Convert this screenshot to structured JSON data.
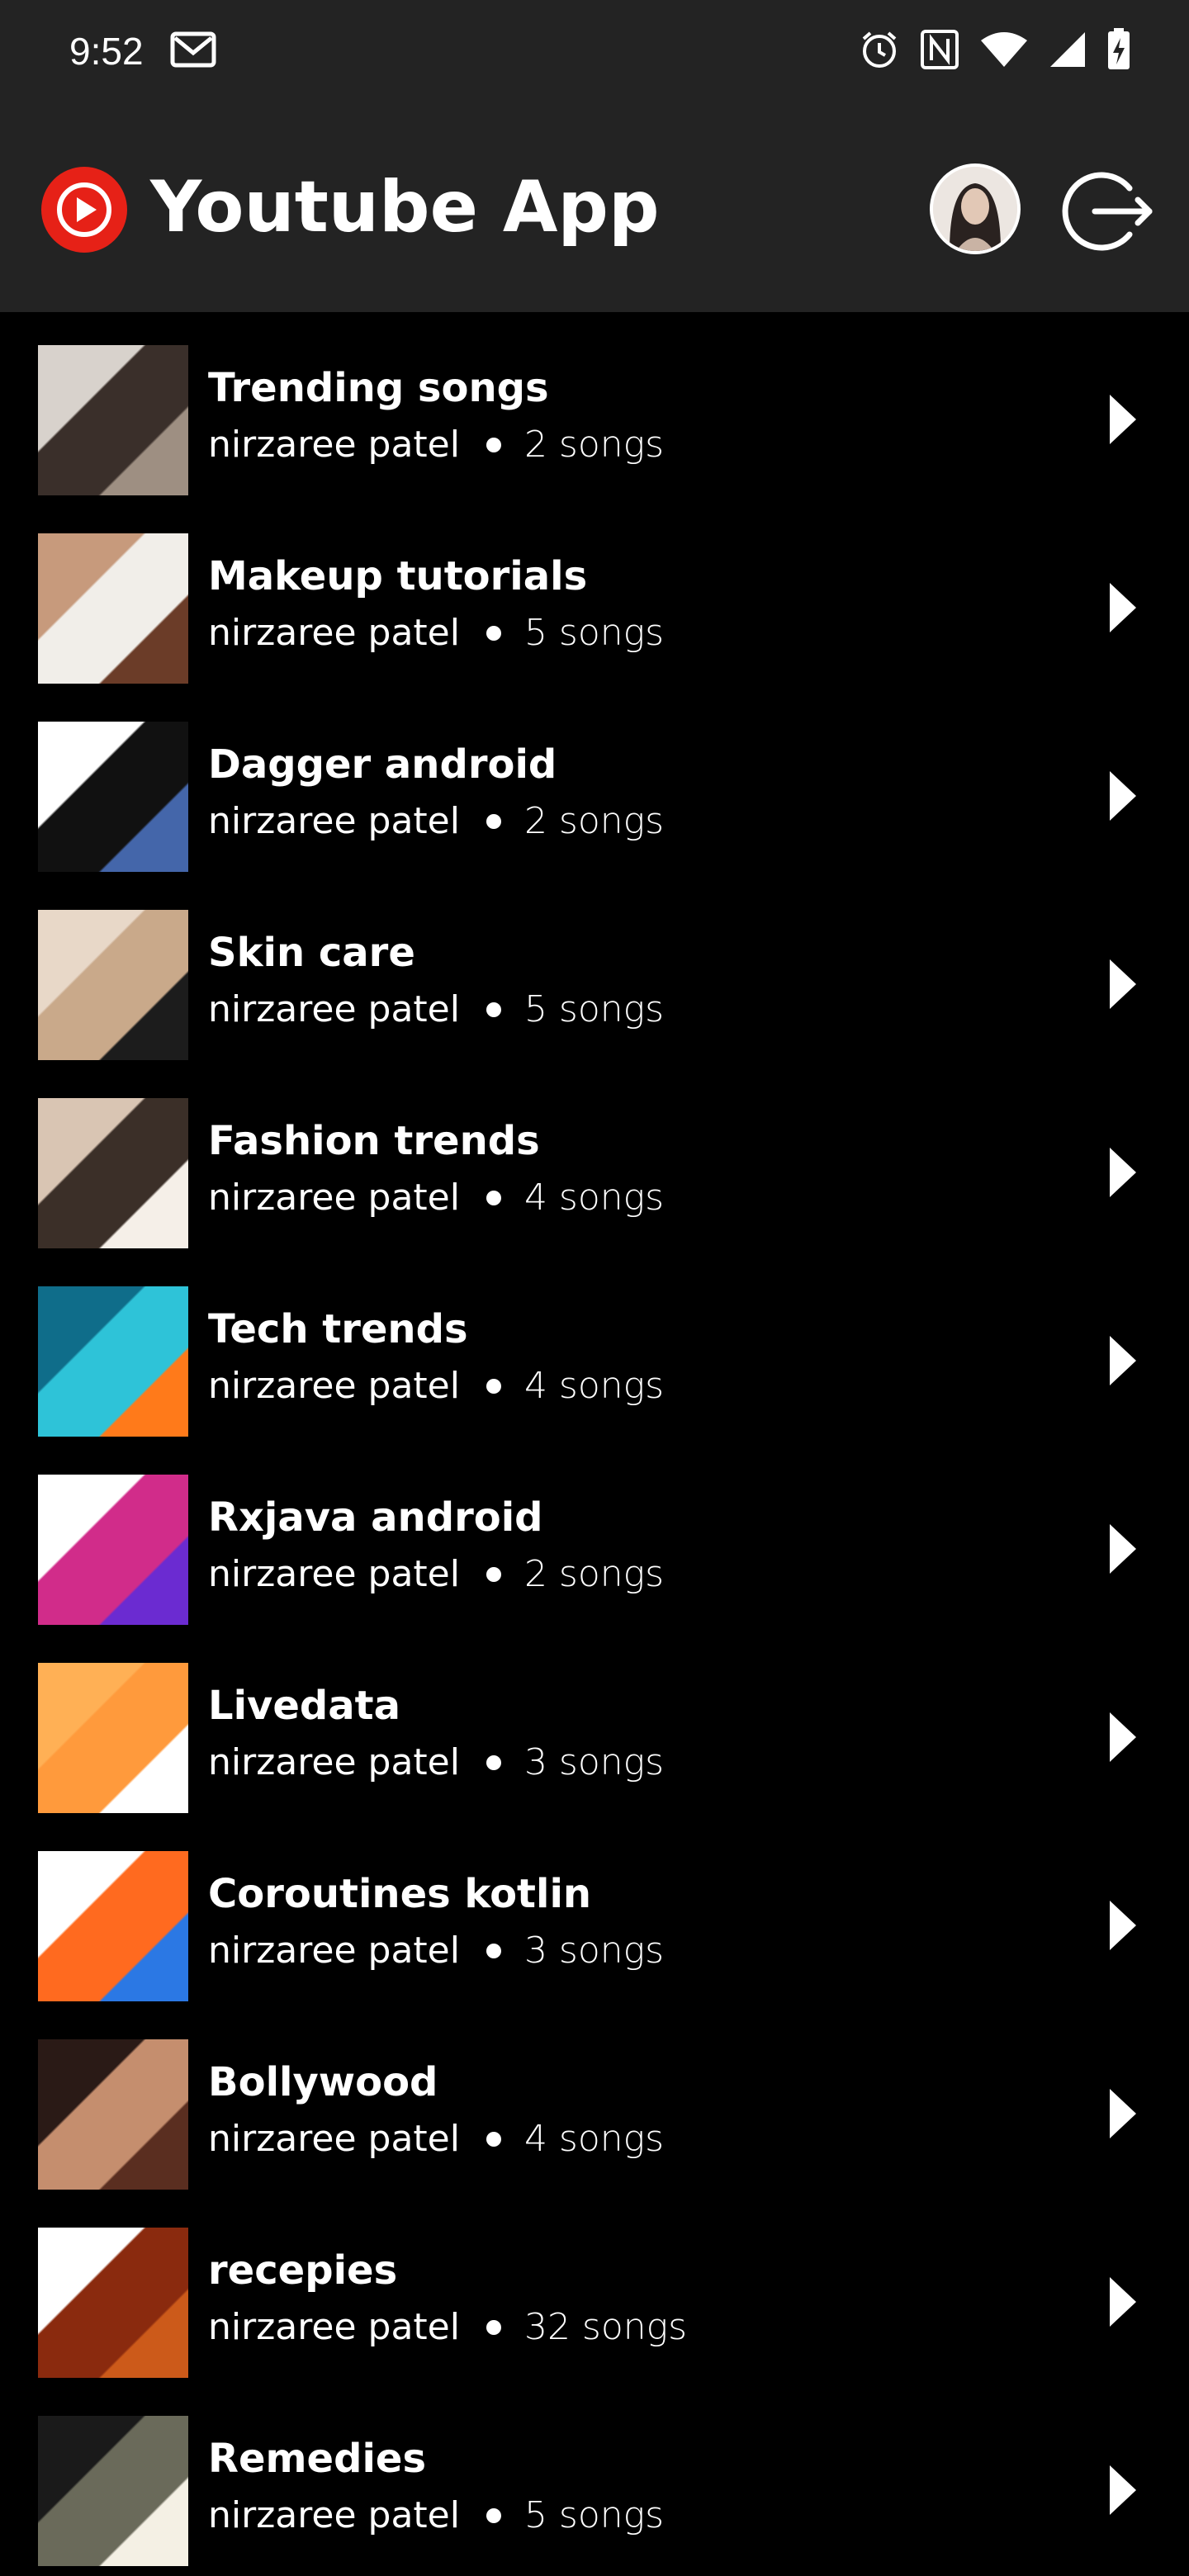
{
  "status_bar": {
    "time": "9:52",
    "icons": [
      "gmail-icon",
      "alarm-icon",
      "nfc-icon",
      "wifi-icon",
      "cellular-signal-icon",
      "battery-charging-icon"
    ]
  },
  "app_bar": {
    "title": "Youtube App",
    "logo_icon": "youtube-play-icon",
    "avatar_icon": "user-avatar",
    "logout_icon": "logout-icon",
    "accent_color": "#e62117"
  },
  "separator": "●",
  "playlists": [
    {
      "title": "Trending songs",
      "owner": "nirzaree patel",
      "count": "2 songs",
      "colors": [
        "#d8d2cc",
        "#3a2f2a",
        "#9e8f82"
      ]
    },
    {
      "title": "Makeup tutorials",
      "owner": "nirzaree patel",
      "count": "5 songs",
      "colors": [
        "#c79a7c",
        "#f1eee9",
        "#6b3c28"
      ]
    },
    {
      "title": "Dagger android",
      "owner": "nirzaree patel",
      "count": "2 songs",
      "colors": [
        "#ffffff",
        "#111111",
        "#4466aa"
      ]
    },
    {
      "title": "Skin care",
      "owner": "nirzaree patel",
      "count": "5 songs",
      "colors": [
        "#e8d8c8",
        "#c9a98a",
        "#1c1c1c"
      ]
    },
    {
      "title": "Fashion trends",
      "owner": "nirzaree patel",
      "count": "4 songs",
      "colors": [
        "#d9c5b3",
        "#3b2f28",
        "#f5efe8"
      ]
    },
    {
      "title": "Tech trends",
      "owner": "nirzaree patel",
      "count": "4 songs",
      "colors": [
        "#0f6d8a",
        "#2ec3d8",
        "#ff7a1a"
      ]
    },
    {
      "title": "Rxjava android",
      "owner": "nirzaree patel",
      "count": "2 songs",
      "colors": [
        "#ffffff",
        "#d12c8a",
        "#6b2bd1"
      ]
    },
    {
      "title": "Livedata",
      "owner": "nirzaree patel",
      "count": "3 songs",
      "colors": [
        "#ffb055",
        "#ff9a3c",
        "#ffffff"
      ]
    },
    {
      "title": "Coroutines kotlin",
      "owner": "nirzaree patel",
      "count": "3 songs",
      "colors": [
        "#ffffff",
        "#ff6a1f",
        "#2b78e4"
      ]
    },
    {
      "title": "Bollywood",
      "owner": "nirzaree patel",
      "count": "4 songs",
      "colors": [
        "#2a1a16",
        "#c58e6e",
        "#5a2e20"
      ]
    },
    {
      "title": "recepies",
      "owner": "nirzaree patel",
      "count": "32 songs",
      "colors": [
        "#ffffff",
        "#8a2a0e",
        "#cc5a1a"
      ]
    },
    {
      "title": "Remedies",
      "owner": "nirzaree patel",
      "count": "5 songs",
      "colors": [
        "#1a1a1a",
        "#6a6a5a",
        "#f4f0e4"
      ]
    }
  ]
}
